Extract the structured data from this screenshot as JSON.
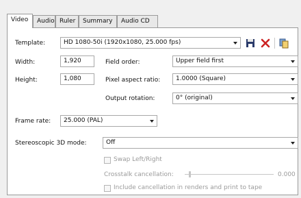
{
  "tabs": [
    "Video",
    "Audio",
    "Ruler",
    "Summary",
    "Audio CD"
  ],
  "template": {
    "label": "Template:",
    "value": "HD 1080-50i (1920x1080, 25.000 fps)"
  },
  "width": {
    "label": "Width:",
    "value": "1,920"
  },
  "height": {
    "label": "Height:",
    "value": "1,080"
  },
  "field_order": {
    "label": "Field order:",
    "value": "Upper field first"
  },
  "pixel_aspect": {
    "label": "Pixel aspect ratio:",
    "value": "1.0000 (Square)"
  },
  "output_rotation": {
    "label": "Output rotation:",
    "value": "0° (original)"
  },
  "frame_rate": {
    "label": "Frame rate:",
    "value": "25.000 (PAL)"
  },
  "stereo": {
    "label": "Stereoscopic 3D mode:",
    "value": "Off"
  },
  "swap_label": "Swap Left/Right",
  "crosstalk": {
    "label": "Crosstalk cancellation:",
    "value": "0.000"
  },
  "include_label": "Include cancellation in renders and print to tape",
  "icons": [
    "save-icon",
    "delete-icon",
    "copy-icon"
  ],
  "colors": {
    "delete": "#cc2222",
    "save": "#2a3a6a"
  }
}
